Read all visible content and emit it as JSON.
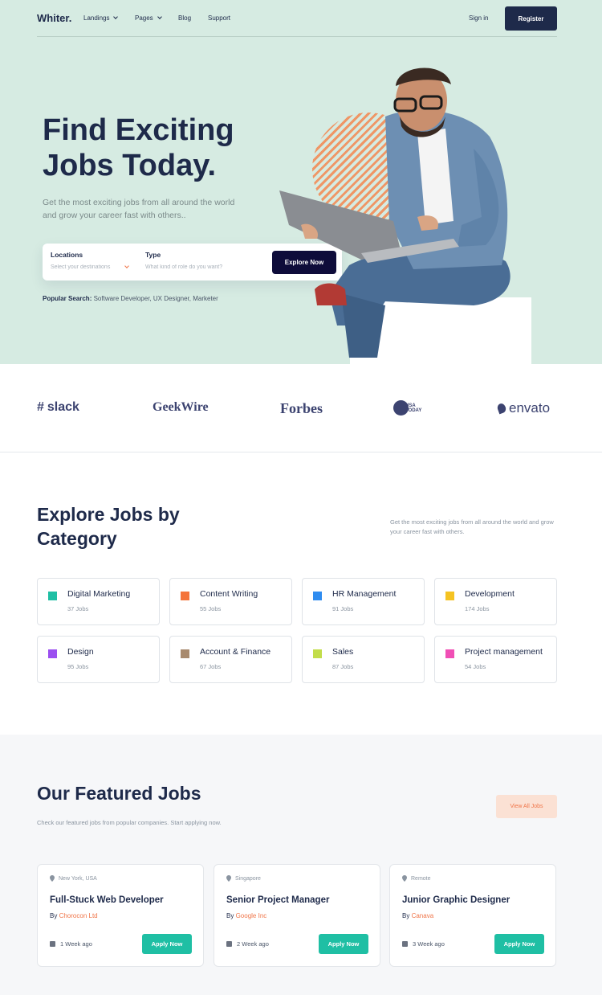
{
  "nav": {
    "logo": "Whiter.",
    "items": [
      {
        "label": "Landings",
        "dropdown": true
      },
      {
        "label": "Pages",
        "dropdown": true
      },
      {
        "label": "Blog",
        "dropdown": false
      },
      {
        "label": "Support",
        "dropdown": false
      }
    ],
    "signin": "Sign in",
    "register": "Register"
  },
  "hero": {
    "title": "Find Exciting Jobs Today.",
    "description": "Get the most exciting jobs from all around the world and grow your career fast with others..",
    "search": {
      "location_label": "Locations",
      "location_placeholder": "Select your destinations",
      "type_label": "Type",
      "type_placeholder": "What kind of role do you want?",
      "button": "Explore Now"
    },
    "popular_label": "Popular Search:",
    "popular_items": "Software Developer, UX Designer, Marketer"
  },
  "brands": [
    "slack",
    "GeekWire",
    "Forbes",
    "USA TODAY",
    "envato"
  ],
  "categories": {
    "title": "Explore Jobs by Category",
    "description": "Get the most exciting jobs from all around the world and grow your career fast with others.",
    "items": [
      {
        "name": "Digital Marketing",
        "count": "37 Jobs",
        "color": "#1fbfa4"
      },
      {
        "name": "Content Writing",
        "count": "55 Jobs",
        "color": "#f4733a"
      },
      {
        "name": "HR Management",
        "count": "91 Jobs",
        "color": "#2f8cf0"
      },
      {
        "name": "Development",
        "count": "174 Jobs",
        "color": "#f5c322"
      },
      {
        "name": "Design",
        "count": "95 Jobs",
        "color": "#9b4ff0"
      },
      {
        "name": "Account & Finance",
        "count": "67 Jobs",
        "color": "#a88a6e"
      },
      {
        "name": "Sales",
        "count": "87 Jobs",
        "color": "#c2dd4a"
      },
      {
        "name": "Project management",
        "count": "54 Jobs",
        "color": "#f04fb5"
      }
    ]
  },
  "featured": {
    "title": "Our Featured Jobs",
    "description": "Check our featured jobs from popular companies. Start applying now.",
    "view_all": "View All Jobs",
    "jobs": [
      {
        "location": "New York, USA",
        "title": "Full-Stuck Web Developer",
        "by": "By",
        "company": "Chorocon Ltd",
        "time": "1 Week ago",
        "apply": "Apply Now"
      },
      {
        "location": "Singapore",
        "title": "Senior Project Manager",
        "by": "By",
        "company": "Google Inc",
        "time": "2 Week ago",
        "apply": "Apply Now"
      },
      {
        "location": "Remote",
        "title": "Junior Graphic Designer",
        "by": "By",
        "company": "Canava",
        "time": "3 Week ago",
        "apply": "Apply Now"
      }
    ]
  },
  "colors": {
    "hero_bg": "#d6ebe2",
    "navy": "#1e2a4a",
    "accent_orange": "#f0764a",
    "accent_teal": "#1fbfa4"
  }
}
